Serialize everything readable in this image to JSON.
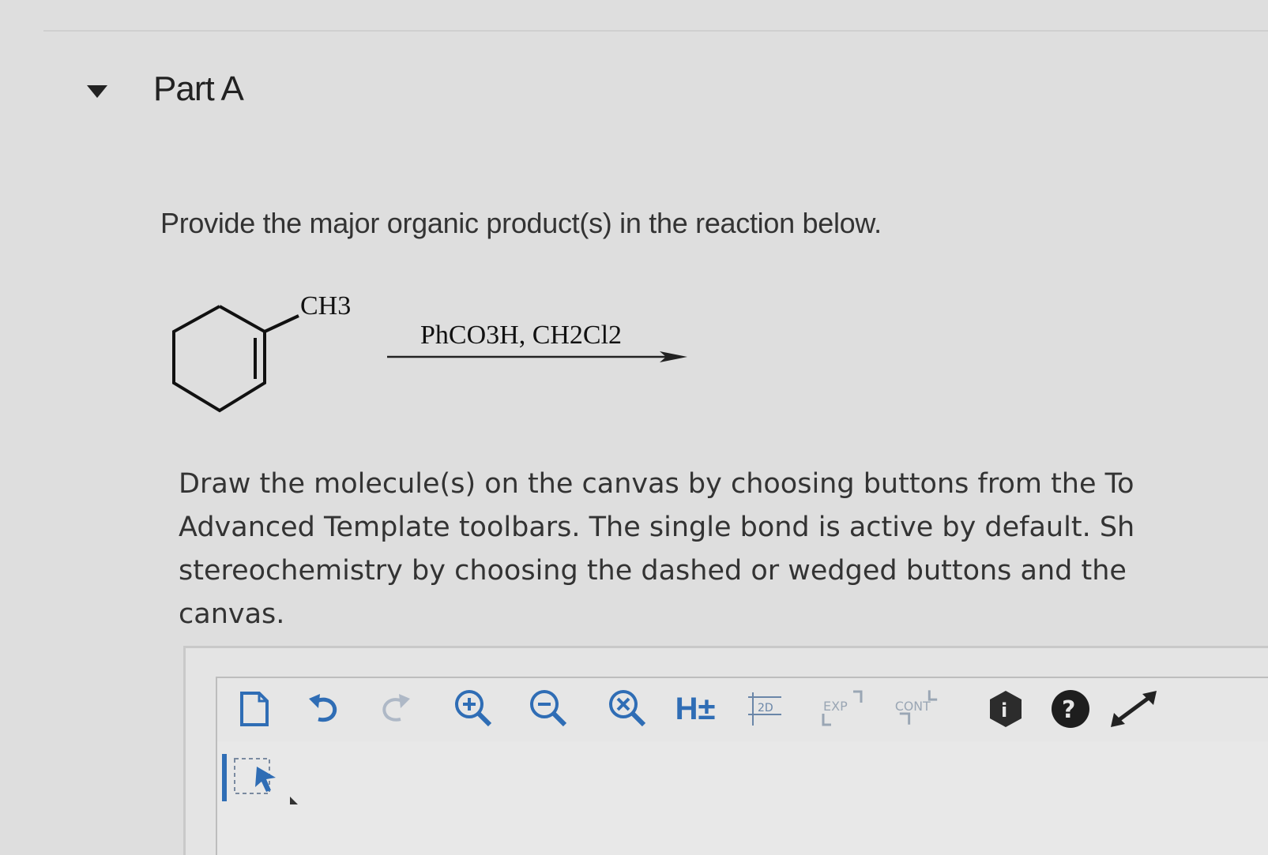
{
  "part": {
    "title": "Part A",
    "toggle_icon": "caret-down-icon"
  },
  "question": {
    "prompt": "Provide the major organic product(s) in the reaction below."
  },
  "reaction": {
    "substituent_label": "CH3",
    "reagents_label": "PhCO3H, CH2Cl2",
    "reactant_icon": "methylcyclohexene-structure"
  },
  "instructions": {
    "lines": [
      "Draw the molecule(s) on the canvas by choosing buttons from the To",
      "Advanced Template toolbars. The single bond is active by default. Sh",
      "stereochemistry by choosing the dashed or wedged buttons and the",
      "canvas."
    ]
  },
  "toolbar": {
    "hydrogen_label": "H±",
    "two_d_label": "2D",
    "exp_label": "EXP",
    "cont_label": "CONT",
    "help_label": "?",
    "info_label": "i",
    "icons": [
      "new-document-icon",
      "undo-icon",
      "redo-icon",
      "zoom-in-icon",
      "zoom-out-icon",
      "zoom-reset-icon",
      "hydrogen-toggle-icon",
      "clean-2d-icon",
      "expand-icon",
      "contract-icon",
      "info-icon",
      "help-icon",
      "fullscreen-icon"
    ]
  },
  "colors": {
    "background": "#dedede",
    "text": "#333333",
    "accent_blue": "#2f6db5"
  }
}
